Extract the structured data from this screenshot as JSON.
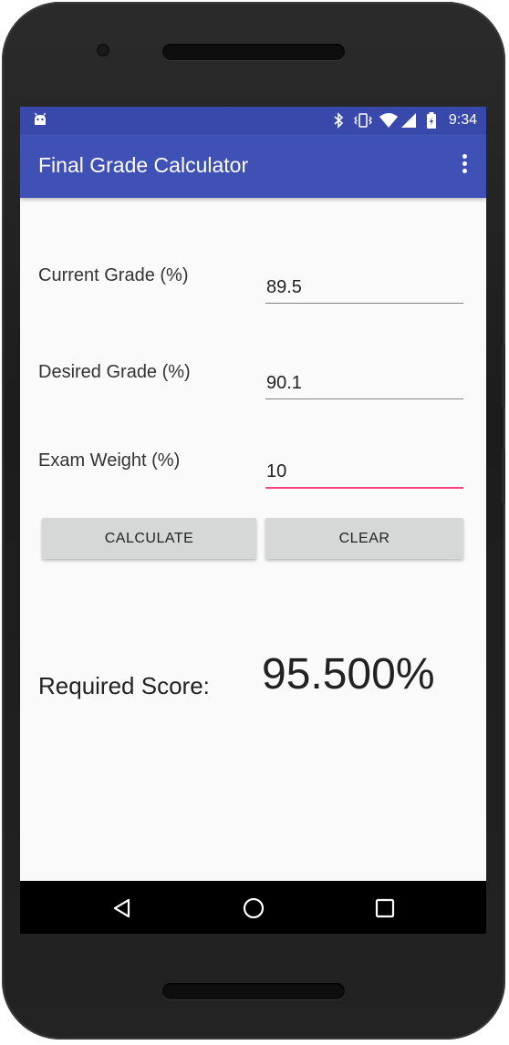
{
  "status_bar": {
    "time": "9:34",
    "icons": [
      "android-icon",
      "bluetooth-icon",
      "vibrate-icon",
      "wifi-icon",
      "signal-icon",
      "battery-charging-icon"
    ]
  },
  "app_bar": {
    "title": "Final Grade Calculator",
    "overflow_icon": "more-vert-icon"
  },
  "form": {
    "current_grade": {
      "label": "Current Grade (%)",
      "value": "89.5"
    },
    "desired_grade": {
      "label": "Desired Grade (%)",
      "value": "90.1"
    },
    "exam_weight": {
      "label": "Exam Weight (%)",
      "value": "10"
    }
  },
  "buttons": {
    "calculate": "CALCULATE",
    "clear": "CLEAR"
  },
  "result": {
    "label": "Required Score:",
    "value": "95.500%"
  },
  "nav_bar": {
    "icons": [
      "back-icon",
      "home-icon",
      "recents-icon"
    ]
  },
  "colors": {
    "status_bar": "#3949ab",
    "app_bar": "#3f51b5",
    "accent": "#ff4081",
    "button": "#d6d7d7"
  }
}
